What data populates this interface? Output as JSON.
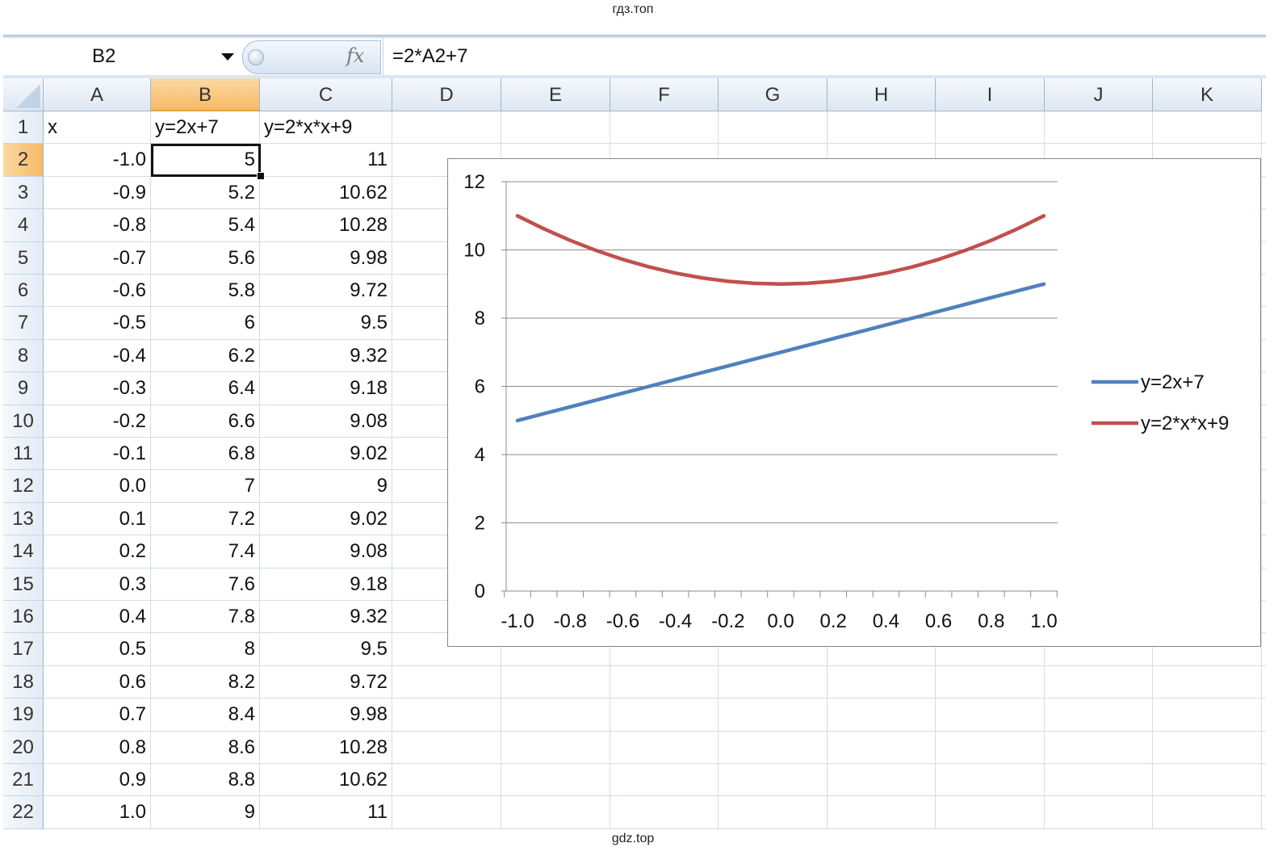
{
  "watermarks": {
    "top": "гдз.топ",
    "bottom": "gdz.top"
  },
  "formula_bar": {
    "name_box": "B2",
    "fx_label": "fx",
    "formula": "=2*A2+7"
  },
  "columns": [
    "A",
    "B",
    "C",
    "D",
    "E",
    "F",
    "G",
    "H",
    "I",
    "J",
    "K"
  ],
  "active": {
    "column": "B",
    "row": 2
  },
  "rows": [
    {
      "row": "1",
      "a": "x",
      "b": "y=2x+7",
      "c": "y=2*x*x+9"
    },
    {
      "row": "2",
      "a": "-1.0",
      "b": "5",
      "c": "11"
    },
    {
      "row": "3",
      "a": "-0.9",
      "b": "5.2",
      "c": "10.62"
    },
    {
      "row": "4",
      "a": "-0.8",
      "b": "5.4",
      "c": "10.28"
    },
    {
      "row": "5",
      "a": "-0.7",
      "b": "5.6",
      "c": "9.98"
    },
    {
      "row": "6",
      "a": "-0.6",
      "b": "5.8",
      "c": "9.72"
    },
    {
      "row": "7",
      "a": "-0.5",
      "b": "6",
      "c": "9.5"
    },
    {
      "row": "8",
      "a": "-0.4",
      "b": "6.2",
      "c": "9.32"
    },
    {
      "row": "9",
      "a": "-0.3",
      "b": "6.4",
      "c": "9.18"
    },
    {
      "row": "10",
      "a": "-0.2",
      "b": "6.6",
      "c": "9.08"
    },
    {
      "row": "11",
      "a": "-0.1",
      "b": "6.8",
      "c": "9.02"
    },
    {
      "row": "12",
      "a": "0.0",
      "b": "7",
      "c": "9"
    },
    {
      "row": "13",
      "a": "0.1",
      "b": "7.2",
      "c": "9.02"
    },
    {
      "row": "14",
      "a": "0.2",
      "b": "7.4",
      "c": "9.08"
    },
    {
      "row": "15",
      "a": "0.3",
      "b": "7.6",
      "c": "9.18"
    },
    {
      "row": "16",
      "a": "0.4",
      "b": "7.8",
      "c": "9.32"
    },
    {
      "row": "17",
      "a": "0.5",
      "b": "8",
      "c": "9.5"
    },
    {
      "row": "18",
      "a": "0.6",
      "b": "8.2",
      "c": "9.72"
    },
    {
      "row": "19",
      "a": "0.7",
      "b": "8.4",
      "c": "9.98"
    },
    {
      "row": "20",
      "a": "0.8",
      "b": "8.6",
      "c": "10.28"
    },
    {
      "row": "21",
      "a": "0.9",
      "b": "8.8",
      "c": "10.62"
    },
    {
      "row": "22",
      "a": "1.0",
      "b": "9",
      "c": "11"
    }
  ],
  "chart_data": {
    "type": "line",
    "x": [
      -1.0,
      -0.9,
      -0.8,
      -0.7,
      -0.6,
      -0.5,
      -0.4,
      -0.3,
      -0.2,
      -0.1,
      0.0,
      0.1,
      0.2,
      0.3,
      0.4,
      0.5,
      0.6,
      0.7,
      0.8,
      0.9,
      1.0
    ],
    "x_tick_labels": [
      "-1.0",
      "-0.8",
      "-0.6",
      "-0.4",
      "-0.2",
      "0.0",
      "0.2",
      "0.4",
      "0.6",
      "0.8",
      "1.0"
    ],
    "y_ticks": [
      0,
      2,
      4,
      6,
      8,
      10,
      12
    ],
    "ylim": [
      0,
      12
    ],
    "grid": true,
    "legend": "right",
    "series": [
      {
        "name": "y=2x+7",
        "color": "#4f81bd",
        "values": [
          5,
          5.2,
          5.4,
          5.6,
          5.8,
          6,
          6.2,
          6.4,
          6.6,
          6.8,
          7,
          7.2,
          7.4,
          7.6,
          7.8,
          8,
          8.2,
          8.4,
          8.6,
          8.8,
          9
        ]
      },
      {
        "name": "y=2*x*x+9",
        "color": "#c0504d",
        "values": [
          11,
          10.62,
          10.28,
          9.98,
          9.72,
          9.5,
          9.32,
          9.18,
          9.08,
          9.02,
          9,
          9.02,
          9.08,
          9.18,
          9.32,
          9.5,
          9.72,
          9.98,
          10.28,
          10.62,
          11
        ]
      }
    ]
  }
}
